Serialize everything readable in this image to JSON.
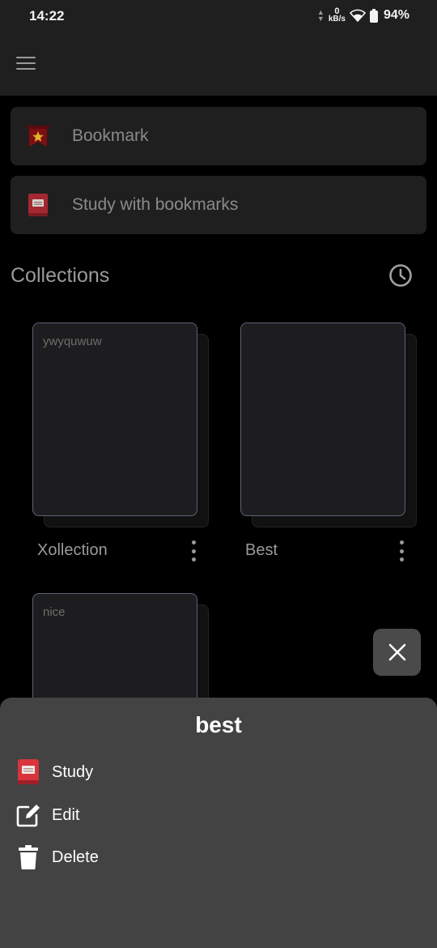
{
  "status_bar": {
    "time": "14:22",
    "net_speed_value": "0",
    "net_speed_unit": "kB/s",
    "battery_percent": "94%"
  },
  "top_bar": {
    "menu_icon": "hamburger-menu-icon"
  },
  "shortcuts": [
    {
      "label": "Bookmark",
      "icon": "bookmark-star-icon"
    },
    {
      "label": "Study with bookmarks",
      "icon": "study-book-icon"
    }
  ],
  "collections_section": {
    "title": "Collections",
    "history_icon": "history-clock-icon",
    "items": [
      {
        "preview_text": "ywyquwuw",
        "name": "Xollection"
      },
      {
        "preview_text": "",
        "name": "Best"
      },
      {
        "preview_text": "nice",
        "name": ""
      }
    ]
  },
  "fab": {
    "icon": "close-icon"
  },
  "bottom_sheet": {
    "title": "best",
    "actions": [
      {
        "label": "Study",
        "icon": "study-book-icon"
      },
      {
        "label": "Edit",
        "icon": "edit-pencil-icon"
      },
      {
        "label": "Delete",
        "icon": "trash-icon"
      }
    ]
  },
  "colors": {
    "background": "#000000",
    "surface": "#1f1f1f",
    "sheet": "#434343",
    "card_border": "#5a6377",
    "bookmark_red": "#8b1010",
    "star_yellow": "#e0b22a",
    "study_red": "#d9343d"
  }
}
